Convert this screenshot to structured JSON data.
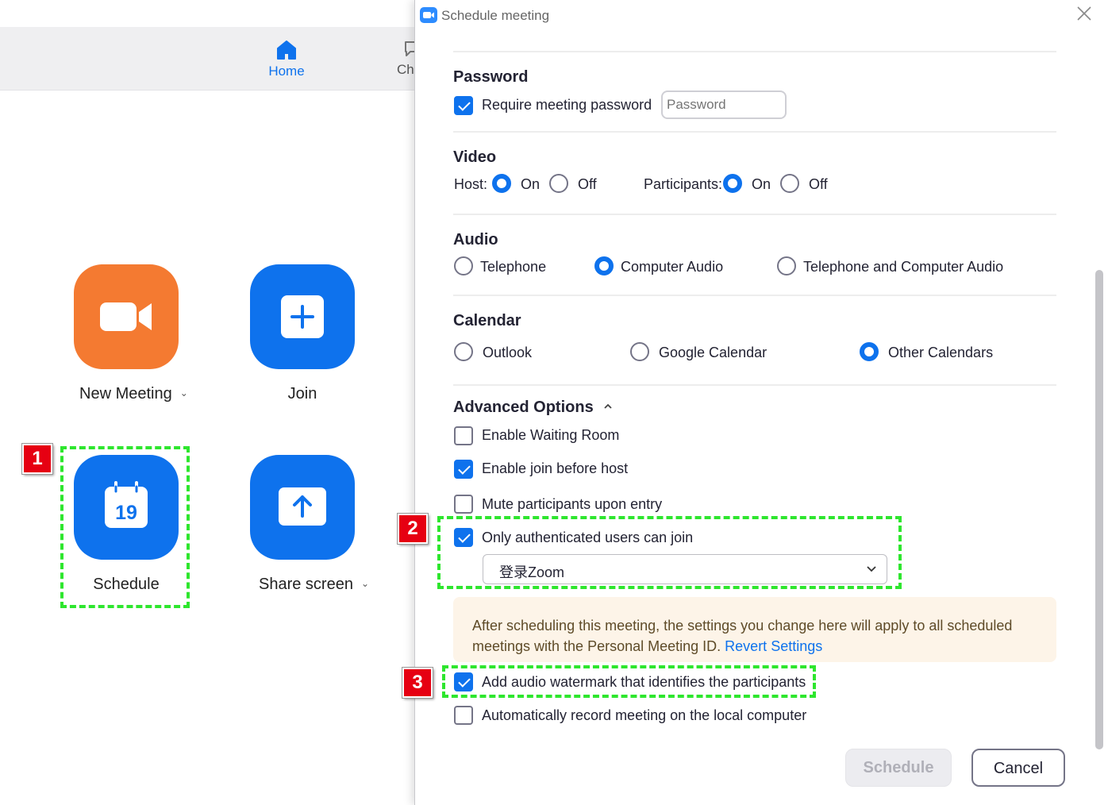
{
  "home": {
    "nav": {
      "home_label": "Home",
      "chat_label": "Ch"
    },
    "tiles": {
      "new_meeting": "New Meeting",
      "join": "Join",
      "schedule": "Schedule",
      "schedule_day": "19",
      "share_screen": "Share screen"
    }
  },
  "markers": [
    "1",
    "2",
    "3"
  ],
  "dialog": {
    "title": "Schedule meeting",
    "password": {
      "heading": "Password",
      "require_label": "Require meeting password",
      "require_checked": true,
      "placeholder": "Password"
    },
    "video": {
      "heading": "Video",
      "host_label": "Host:",
      "participants_label": "Participants:",
      "on": "On",
      "off": "Off",
      "host_value": "On",
      "participants_value": "On"
    },
    "audio": {
      "heading": "Audio",
      "options": [
        "Telephone",
        "Computer Audio",
        "Telephone and Computer Audio"
      ],
      "selected": "Computer Audio"
    },
    "calendar": {
      "heading": "Calendar",
      "options": [
        "Outlook",
        "Google Calendar",
        "Other Calendars"
      ],
      "selected": "Other Calendars"
    },
    "advanced": {
      "heading": "Advanced Options",
      "waiting_room": {
        "label": "Enable Waiting Room",
        "checked": false
      },
      "join_before_host": {
        "label": "Enable join before host",
        "checked": true
      },
      "mute_on_entry": {
        "label": "Mute participants upon entry",
        "checked": false
      },
      "authenticated_only": {
        "label": "Only authenticated users can join",
        "checked": true
      },
      "auth_select_value": "登录Zoom",
      "notice_text": "After scheduling this meeting, the settings you change here will apply to all scheduled meetings with the Personal Meeting ID.",
      "notice_link": "Revert Settings",
      "audio_watermark": {
        "label": "Add audio watermark that identifies the participants",
        "checked": true
      },
      "auto_record": {
        "label": "Automatically record meeting on the local computer",
        "checked": false
      }
    },
    "buttons": {
      "schedule": "Schedule",
      "cancel": "Cancel"
    }
  },
  "colors": {
    "accent": "#0e72ed",
    "orange_tile": "#f47a31",
    "highlight": "#2ee62e",
    "marker": "#e60012"
  }
}
